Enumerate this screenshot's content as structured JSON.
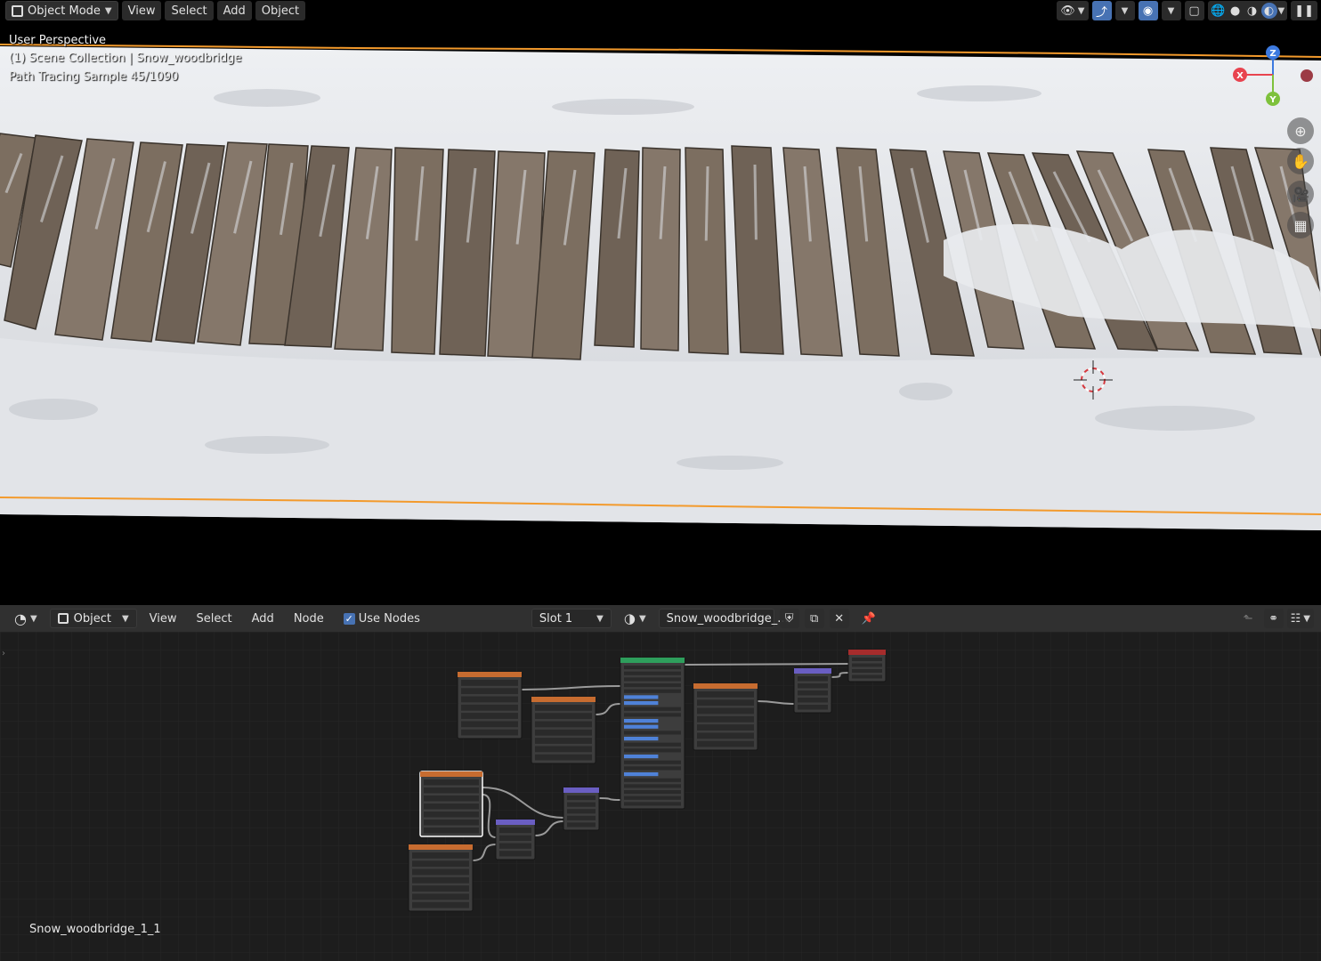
{
  "viewport": {
    "header": {
      "mode_label": "Object Mode",
      "menus": [
        "View",
        "Select",
        "Add",
        "Object"
      ]
    },
    "overlay": {
      "perspective": "User Perspective",
      "collection": "(1) Scene Collection | Snow_woodbridge",
      "render_status": "Path Tracing Sample 45/1090"
    },
    "gizmo": {
      "x_label": "X",
      "y_label": "Y",
      "z_label": "Z"
    },
    "colors": {
      "snow": "#e4e6ea",
      "wood_light": "#8a7a68",
      "wood_dark": "#4f453b",
      "selection_outline": "#f39a2c",
      "axis_x": "#e8434f",
      "axis_y": "#7ec13c",
      "axis_z": "#3d7ae0"
    }
  },
  "node_editor": {
    "header": {
      "editor_icon": "shader-editor-icon",
      "object_label": "Object",
      "menus": [
        "View",
        "Select",
        "Add",
        "Node"
      ],
      "use_nodes_label": "Use Nodes",
      "use_nodes_checked": true,
      "slot_label": "Slot 1",
      "material_name": "Snow_woodbridge_..."
    },
    "material_label": "Snow_woodbridge_1_1",
    "colors": {
      "background": "#1d1d1d",
      "grid": "#262626",
      "node_body": "#3d3d3d",
      "texture_header": "#c76c30",
      "bsdf_header": "#2e9e5c",
      "vector_header": "#6a5ec2",
      "output_header": "#a62c2c",
      "socket_blue": "#4f82d8"
    }
  }
}
